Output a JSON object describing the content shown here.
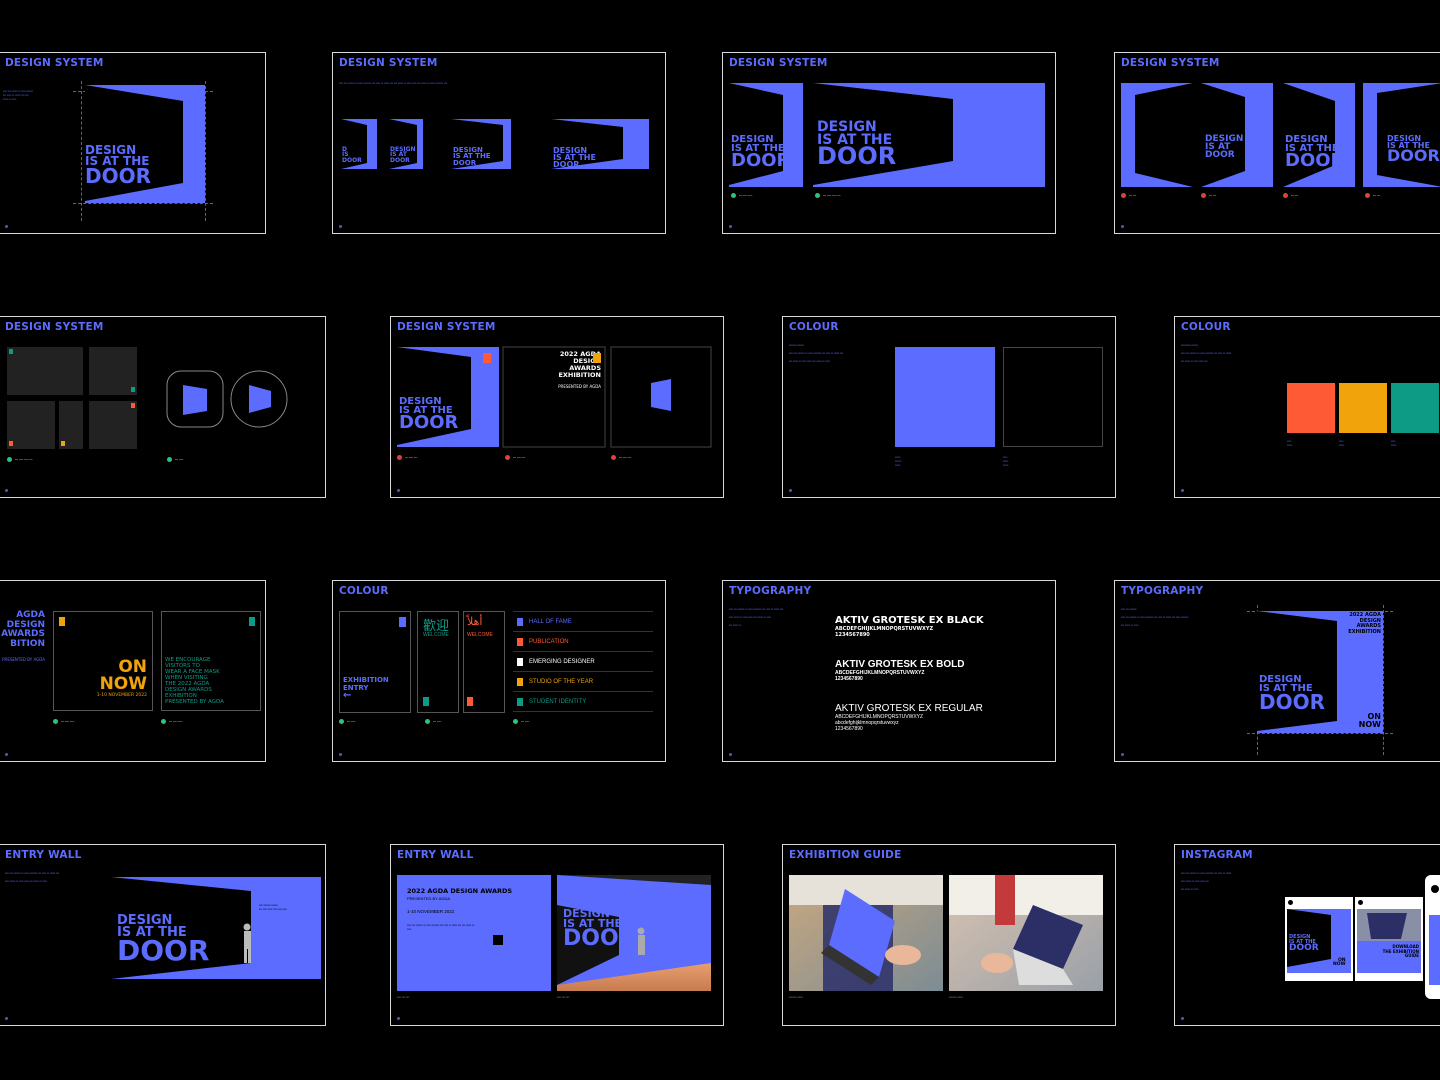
{
  "slides": [
    {
      "title": "DESIGN SYSTEM",
      "lines": [
        "DESIGN",
        "IS AT THE",
        "DOOR"
      ]
    },
    {
      "title": "DESIGN SYSTEM",
      "lines": [
        "DESIGN",
        "IS AT THE",
        "DOOR"
      ]
    },
    {
      "title": "DESIGN SYSTEM",
      "lines": [
        "DESIGN",
        "IS AT THE",
        "DOOR"
      ]
    },
    {
      "title": "DESIGN SYSTEM",
      "lines": [
        "DESIGN",
        "IS AT THE",
        "DOOR"
      ]
    },
    {
      "title": "DESIGN SYSTEM"
    },
    {
      "title": "DESIGN SYSTEM",
      "lines": [
        "DESIGN",
        "IS AT THE",
        "DOOR"
      ],
      "poster": [
        "2022 AGDA",
        "DESIGN",
        "AWARDS",
        "EXHIBITION"
      ],
      "presented": "PRESENTED BY AGDA"
    },
    {
      "title": "COLOUR"
    },
    {
      "title": "COLOUR"
    },
    {
      "title": "",
      "agda": [
        "AGDA",
        "DESIGN",
        "AWARDS",
        "BITION"
      ],
      "presented": "PRESENTED BY AGDA",
      "on_now": [
        "ON",
        "NOW"
      ],
      "dates": "1-10 NOVEMBER 2022",
      "mask": [
        "WE ENCOURAGE",
        "VISITORS TO",
        "WEAR A FACE MASK",
        "WHEN VISITING",
        "THE 2022 AGDA",
        "DESIGN AWARDS",
        "EXHIBITION",
        "PRESENTED BY AGDA"
      ]
    },
    {
      "title": "COLOUR",
      "entry": [
        "EXHIBITION",
        "ENTRY"
      ],
      "welcome_cn": "歡迎",
      "welcome": "WELCOME",
      "welcome_ar": "أهلاً",
      "list": [
        "HALL OF FAME",
        "PUBLICATION",
        "EMERGING DESIGNER",
        "STUDIO OF THE YEAR",
        "STUDENT IDENTITY"
      ]
    },
    {
      "title": "TYPOGRAPHY",
      "fonts": [
        {
          "name": "AKTIV GROTESK EX BLACK",
          "sample1": "ABCDEFGHIJKLMNOPQRSTUVWXYZ",
          "sample2": "1234567890"
        },
        {
          "name": "AKTIV GROTESK EX BOLD",
          "sample1": "ABCDEFGHIJKLMNOPQRSTUVWXYZ",
          "sample2": "1234567890"
        },
        {
          "name": "AKTIV GROTESK EX REGULAR",
          "sample1": "ABCDEFGHIJKLMNOPQRSTUVWXYZ",
          "sample2": "abcdefghijklmnopqrstuvwxyz",
          "sample3": "1234567890"
        }
      ]
    },
    {
      "title": "TYPOGRAPHY",
      "lines": [
        "DESIGN",
        "IS AT THE",
        "DOOR"
      ],
      "poster": [
        "2022 AGDA",
        "DESIGN",
        "AWARDS",
        "EXHIBITION"
      ],
      "on_now": [
        "ON",
        "NOW"
      ]
    },
    {
      "title": "ENTRY WALL",
      "lines": [
        "DESIGN",
        "IS AT THE",
        "DOOR"
      ]
    },
    {
      "title": "ENTRY WALL",
      "heading": "2022 AGDA DESIGN AWARDS",
      "sub": "PRESENTED BY AGDA",
      "dates": "1-10 NOVEMBER 2022",
      "lines": [
        "DESIGN",
        "IS AT THE",
        "DOOR"
      ]
    },
    {
      "title": "EXHIBITION GUIDE"
    },
    {
      "title": "INSTAGRAM",
      "lines": [
        "DESIGN",
        "IS AT THE",
        "DOOR"
      ],
      "on_now": [
        "ON",
        "NOW"
      ],
      "download": [
        "DOWNLOAD",
        "THE EXHIBITION",
        "GUIDE"
      ]
    }
  ],
  "colors": {
    "blue": "#5b6cff",
    "orange": "#ff5a36",
    "yellow": "#f0a30a",
    "teal": "#0e9b86",
    "background": "#000000"
  }
}
